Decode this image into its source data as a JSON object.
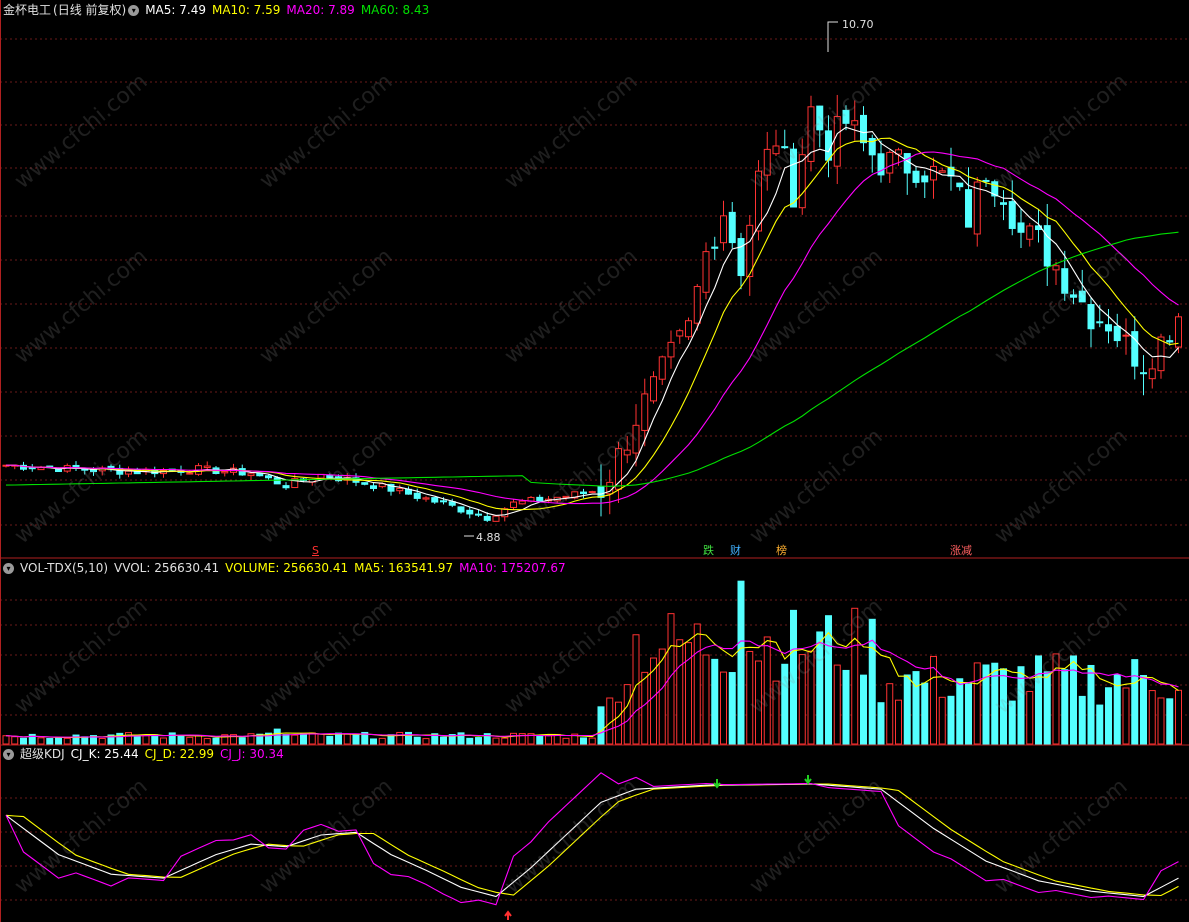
{
  "main_panel": {
    "stock_name": "金杯电工",
    "period_label": "(日线 前复权)",
    "indicators": [
      {
        "label": "MA5: 7.49",
        "color": "#ffffff"
      },
      {
        "label": "MA10: 7.59",
        "color": "#ffff00"
      },
      {
        "label": "MA20: 7.89",
        "color": "#ff00ff"
      },
      {
        "label": "MA60: 8.43",
        "color": "#00e000"
      }
    ],
    "high_label": "10.70",
    "low_label": "4.88",
    "event_tags": [
      {
        "text": "S",
        "color": "#ff3030"
      },
      {
        "text": "跌",
        "color": "#40e040"
      },
      {
        "text": "财",
        "color": "#40b0ff"
      },
      {
        "text": "榜",
        "color": "#ffb030"
      },
      {
        "text": "涨减",
        "color": "#ff6060"
      }
    ]
  },
  "volume_panel": {
    "indicator_name": "VOL-TDX(5,10)",
    "indicators": [
      {
        "label": "VVOL: 256630.41",
        "color": "#e0e0e0"
      },
      {
        "label": "VOLUME: 256630.41",
        "color": "#ffff00"
      },
      {
        "label": "MA5: 163541.97",
        "color": "#ffff00"
      },
      {
        "label": "MA10: 175207.67",
        "color": "#ff00ff"
      }
    ]
  },
  "kdj_panel": {
    "indicator_name": "超级KDJ",
    "indicators": [
      {
        "label": "CJ_K: 25.44",
        "color": "#ffffff"
      },
      {
        "label": "CJ_D: 22.99",
        "color": "#ffff00"
      },
      {
        "label": "CJ_J: 30.34",
        "color": "#ff00ff"
      }
    ]
  },
  "watermark_text": "www.cfchi.com",
  "chart_data": {
    "type": "candlestick",
    "y_range": [
      4.6,
      11.2
    ],
    "up_color": "#ff3232",
    "down_color": "#54ffff",
    "ma5_color": "#ffffff",
    "ma10_color": "#ffff00",
    "ma20_color": "#ff00ff",
    "ma60_color": "#00e000",
    "volume_range": [
      0,
      400000
    ],
    "kdj_range": [
      -10,
      110
    ]
  }
}
